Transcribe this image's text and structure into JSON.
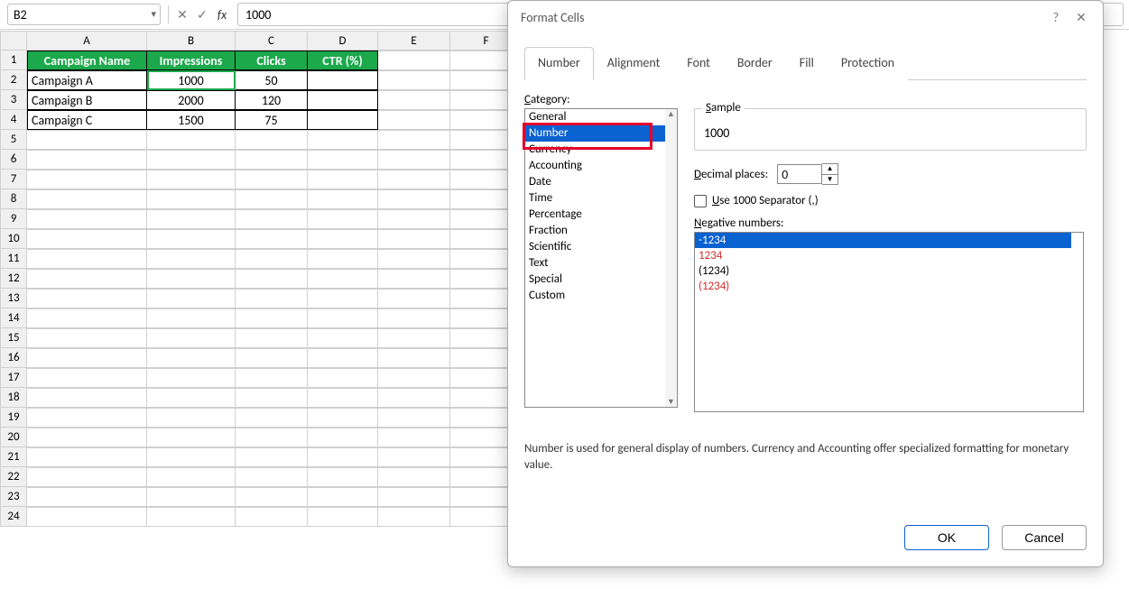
{
  "formula_bar": {
    "name_box": "B2",
    "cancel_glyph": "✕",
    "accept_glyph": "✓",
    "fx_label": "fx",
    "value": "1000"
  },
  "grid": {
    "columns": [
      "A",
      "B",
      "C",
      "D",
      "E",
      "F"
    ],
    "row_numbers": [
      "1",
      "2",
      "3",
      "4",
      "5",
      "6",
      "7",
      "8",
      "9",
      "10",
      "11",
      "12",
      "13",
      "14",
      "15",
      "16",
      "17",
      "18",
      "19",
      "20",
      "21",
      "22",
      "23",
      "24"
    ],
    "headers": {
      "a": "Campaign Name",
      "b": "Impressions",
      "c": "Clicks",
      "d": "CTR (%)"
    },
    "rows": [
      {
        "a": "Campaign A",
        "b": "1000",
        "c": "50",
        "d": ""
      },
      {
        "a": "Campaign B",
        "b": "2000",
        "c": "120",
        "d": ""
      },
      {
        "a": "Campaign C",
        "b": "1500",
        "c": "75",
        "d": ""
      }
    ],
    "selected_cell": "B2"
  },
  "dialog": {
    "title": "Format Cells",
    "help_glyph": "?",
    "close_glyph": "✕",
    "tabs": {
      "number": "Number",
      "alignment": "Alignment",
      "font": "Font",
      "border": "Border",
      "fill": "Fill",
      "protection": "Protection",
      "active": "number"
    },
    "category_label": "Category:",
    "categories": [
      "General",
      "Number",
      "Currency",
      "Accounting",
      "Date",
      "Time",
      "Percentage",
      "Fraction",
      "Scientific",
      "Text",
      "Special",
      "Custom"
    ],
    "category_selected_index": 1,
    "sample": {
      "label": "Sample",
      "value": "1000"
    },
    "decimal_places": {
      "label": "Decimal places:",
      "value": "0"
    },
    "use_separator": {
      "checked": false,
      "label": "Use 1000 Separator (,)"
    },
    "negative": {
      "label": "Negative numbers:",
      "options": [
        {
          "text": "-1234",
          "style": "sel"
        },
        {
          "text": "1234",
          "style": "red"
        },
        {
          "text": "(1234)",
          "style": ""
        },
        {
          "text": "(1234)",
          "style": "red"
        }
      ]
    },
    "help_text": "Number is used for general display of numbers.  Currency and Accounting offer specialized formatting for monetary value.",
    "buttons": {
      "ok": "OK",
      "cancel": "Cancel"
    }
  }
}
